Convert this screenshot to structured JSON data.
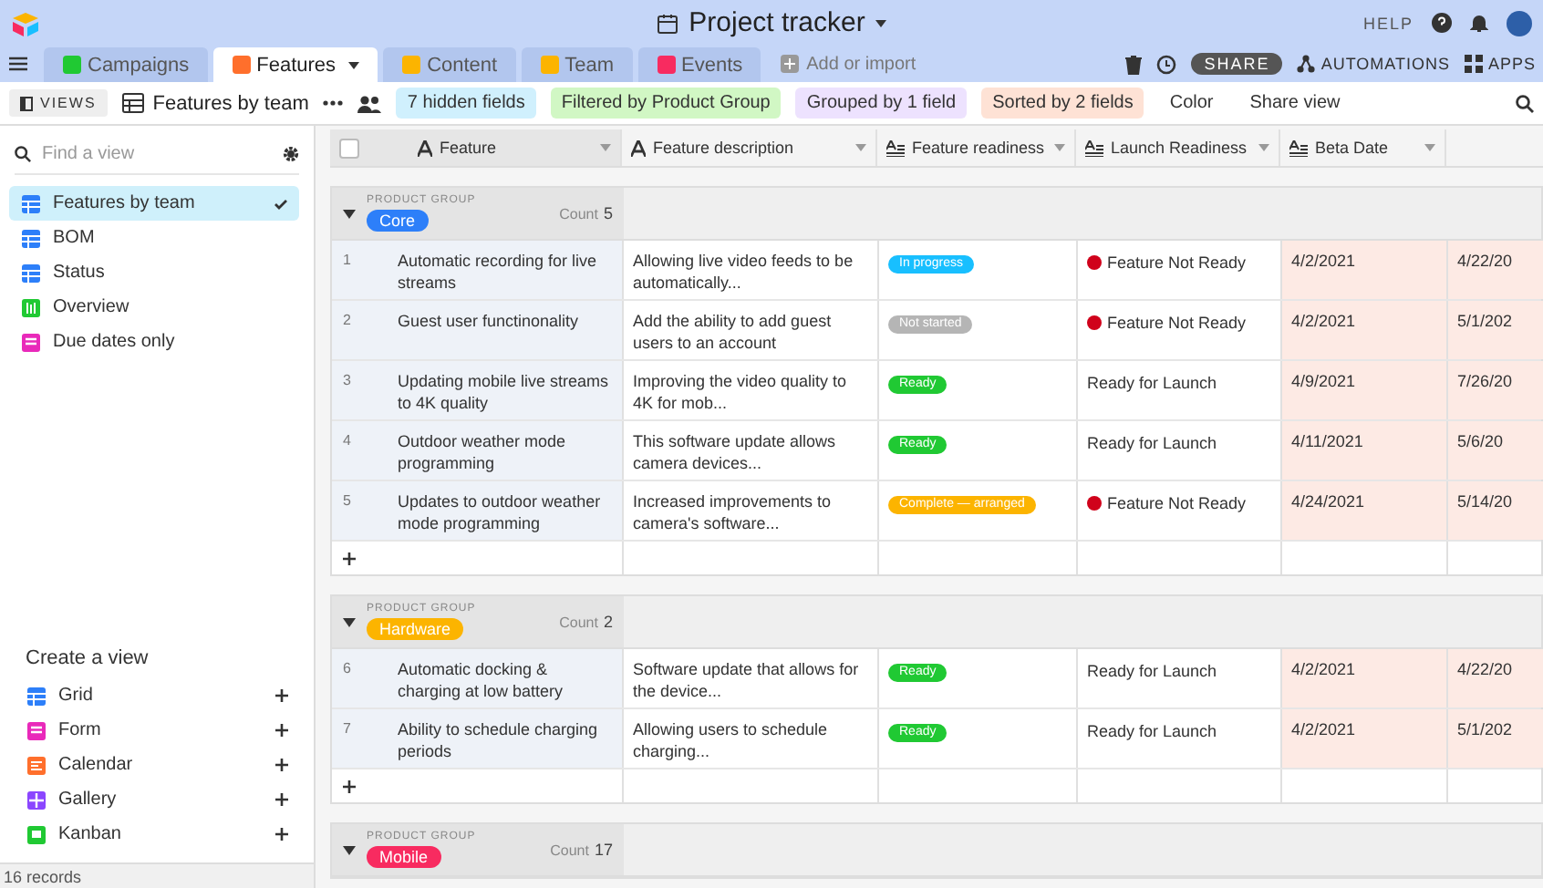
{
  "top_bar": {
    "title": "Project tracker",
    "help": "HELP"
  },
  "tabs": [
    {
      "label": "Campaigns",
      "selected": false
    },
    {
      "label": "Features",
      "selected": true
    },
    {
      "label": "Content",
      "selected": false
    },
    {
      "label": "Team",
      "selected": false
    },
    {
      "label": "Events",
      "selected": false
    }
  ],
  "add_tab": "Add or import",
  "actions": {
    "share": "SHARE",
    "automations": "AUTOMATIONS",
    "apps": "APPS"
  },
  "toolbar": {
    "views_label": "VIEWS",
    "view_name": "Features by team",
    "buttons": [
      {
        "label": "7 hidden fields",
        "kind": "chip",
        "color": "#d0f0fd"
      },
      {
        "label": "Filtered by Product Group",
        "kind": "chip",
        "color": "#d1f7c4"
      },
      {
        "label": "Grouped by 1 field",
        "kind": "chip",
        "color": "#ede2fe"
      },
      {
        "label": "Sorted by 2 fields",
        "kind": "chip",
        "color": "#fee2d5"
      },
      {
        "label": "Color",
        "kind": "plain"
      },
      {
        "label": "Share view",
        "kind": "plain"
      }
    ]
  },
  "sidebar": {
    "search_placeholder": "Find a view",
    "views": [
      {
        "label": "Features by team",
        "kind": "grid",
        "selected": true
      },
      {
        "label": "BOM",
        "kind": "grid",
        "selected": false
      },
      {
        "label": "Status",
        "kind": "grid",
        "selected": false
      },
      {
        "label": "Overview",
        "kind": "timeline",
        "selected": false
      },
      {
        "label": "Due dates only",
        "kind": "form",
        "selected": false
      }
    ],
    "create_title": "Create a view",
    "create": [
      {
        "label": "Grid",
        "kind": "grid"
      },
      {
        "label": "Form",
        "kind": "form"
      },
      {
        "label": "Calendar",
        "kind": "calendar"
      },
      {
        "label": "Gallery",
        "kind": "gallery"
      },
      {
        "label": "Kanban",
        "kind": "kanban"
      }
    ]
  },
  "grid": {
    "select_all_checked": false,
    "columns": [
      {
        "label": "Feature",
        "kind": "text"
      },
      {
        "label": "Feature description",
        "kind": "text"
      },
      {
        "label": "Feature readiness",
        "kind": "formula"
      },
      {
        "label": "Launch Readiness",
        "kind": "formula"
      },
      {
        "label": "Beta Date",
        "kind": "formula"
      }
    ],
    "groups": [
      {
        "field": "PRODUCT GROUP",
        "name": "Core",
        "color": "#2d7ff9",
        "count_label": "Count",
        "count": "5",
        "expanded": true,
        "rows": [
          {
            "number": "1",
            "feature": "Automatic recording for live streams",
            "description": "Allowing live video feeds to be automatically...",
            "readiness": {
              "label": "In progress",
              "color": "#18bfff"
            },
            "launch": {
              "label": "Feature Not Ready",
              "kind": "not_ready"
            },
            "beta_date": "4/2/2021",
            "column_6": "4/22/20"
          },
          {
            "number": "2",
            "feature": "Guest user functinonality",
            "description": "Add the ability to add guest users to an account",
            "readiness": {
              "label": "Not started",
              "color": "#b5b5b5"
            },
            "launch": {
              "label": "Feature Not Ready",
              "kind": "not_ready"
            },
            "beta_date": "4/2/2021",
            "column_6": "5/1/202"
          },
          {
            "number": "3",
            "feature": "Updating mobile live streams to 4K quality",
            "description": "Improving the video quality to 4K for mob...",
            "readiness": {
              "label": "Ready",
              "color": "#20c933"
            },
            "launch": {
              "label": "Ready for Launch",
              "kind": "ready"
            },
            "beta_date": "4/9/2021",
            "column_6": "7/26/20"
          },
          {
            "number": "4",
            "feature": "Outdoor weather mode programming",
            "description": "This software update allows camera devices...",
            "readiness": {
              "label": "Ready",
              "color": "#20c933"
            },
            "launch": {
              "label": "Ready for Launch",
              "kind": "ready"
            },
            "beta_date": "4/11/2021",
            "column_6": "5/6/20"
          },
          {
            "number": "5",
            "feature": "Updates to outdoor weather mode programming",
            "description": "Increased improvements to camera's software...",
            "readiness": {
              "label": "Complete — arranged",
              "color": "#fcb400"
            },
            "launch": {
              "label": "Feature Not Ready",
              "kind": "not_ready"
            },
            "beta_date": "4/24/2021",
            "column_6": "5/14/20"
          }
        ]
      },
      {
        "field": "PRODUCT GROUP",
        "name": "Hardware",
        "color": "#fcb400",
        "count_label": "Count",
        "count": "2",
        "expanded": true,
        "rows": [
          {
            "number": "6",
            "feature": "Automatic docking & charging at low battery",
            "description": "Software update that allows for the device...",
            "readiness": {
              "label": "Ready",
              "color": "#20c933"
            },
            "launch": {
              "label": "Ready for Launch",
              "kind": "ready"
            },
            "beta_date": "4/2/2021",
            "column_6": "4/22/20"
          },
          {
            "number": "7",
            "feature": "Ability to schedule charging periods",
            "description": "Allowing users to schedule charging...",
            "readiness": {
              "label": "Ready",
              "color": "#20c933"
            },
            "launch": {
              "label": "Ready for Launch",
              "kind": "ready"
            },
            "beta_date": "4/2/2021",
            "column_6": "5/1/202"
          }
        ]
      },
      {
        "field": "PRODUCT GROUP",
        "name": "Mobile",
        "color": "#f82b60",
        "count_label": "Count",
        "count": "17",
        "expanded": true
      }
    ]
  },
  "status_bar": "16 records"
}
